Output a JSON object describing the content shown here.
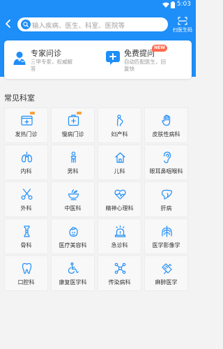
{
  "status_bar": {
    "time": "5:03",
    "wifi_icon": "wifi-icon",
    "battery_icon": "battery-icon"
  },
  "header": {
    "back_icon": "back-arrow-icon",
    "search_placeholder": "输入疾病、医生、科室、医院等",
    "scan_label": "扫医生码",
    "background_color": "#1e8ef8"
  },
  "services": [
    {
      "title": "专家问诊",
      "desc": "三甲专家，权威解答",
      "icon": "doctor-icon"
    },
    {
      "title": "免费提问",
      "desc": "自动匹配医生，回复快",
      "icon": "plus-chat-icon",
      "badge": "NEW"
    }
  ],
  "section_title": "常见科室",
  "departments": [
    {
      "label": "发热门诊",
      "icon": "fever-clinic-icon",
      "tag": true
    },
    {
      "label": "慢病门诊",
      "icon": "chronic-clinic-icon",
      "tag": true
    },
    {
      "label": "妇产科",
      "icon": "obstetrics-icon"
    },
    {
      "label": "皮肤性病科",
      "icon": "hand-dermatology-icon"
    },
    {
      "label": "内科",
      "icon": "lungs-icon"
    },
    {
      "label": "男科",
      "icon": "male-icon"
    },
    {
      "label": "儿科",
      "icon": "child-icon"
    },
    {
      "label": "眼耳鼻咽喉科",
      "icon": "ear-icon"
    },
    {
      "label": "外科",
      "icon": "scissors-icon"
    },
    {
      "label": "中医科",
      "icon": "herbal-bowl-icon"
    },
    {
      "label": "精神心理科",
      "icon": "heart-pulse-icon"
    },
    {
      "label": "肝病",
      "icon": "liver-icon"
    },
    {
      "label": "骨科",
      "icon": "bone-icon"
    },
    {
      "label": "医疗美容科",
      "icon": "beauty-icon"
    },
    {
      "label": "急诊科",
      "icon": "emergency-light-icon"
    },
    {
      "label": "医学影像学",
      "icon": "xray-chest-icon"
    },
    {
      "label": "口腔科",
      "icon": "tooth-icon"
    },
    {
      "label": "康复医学科",
      "icon": "wheelchair-icon"
    },
    {
      "label": "传染病科",
      "icon": "virus-icon"
    },
    {
      "label": "麻醉医学",
      "icon": "anesthesia-icon"
    }
  ],
  "colors": {
    "accent": "#1e8ef8",
    "badge": "#fe6b50",
    "tag": "#f8a13f"
  }
}
